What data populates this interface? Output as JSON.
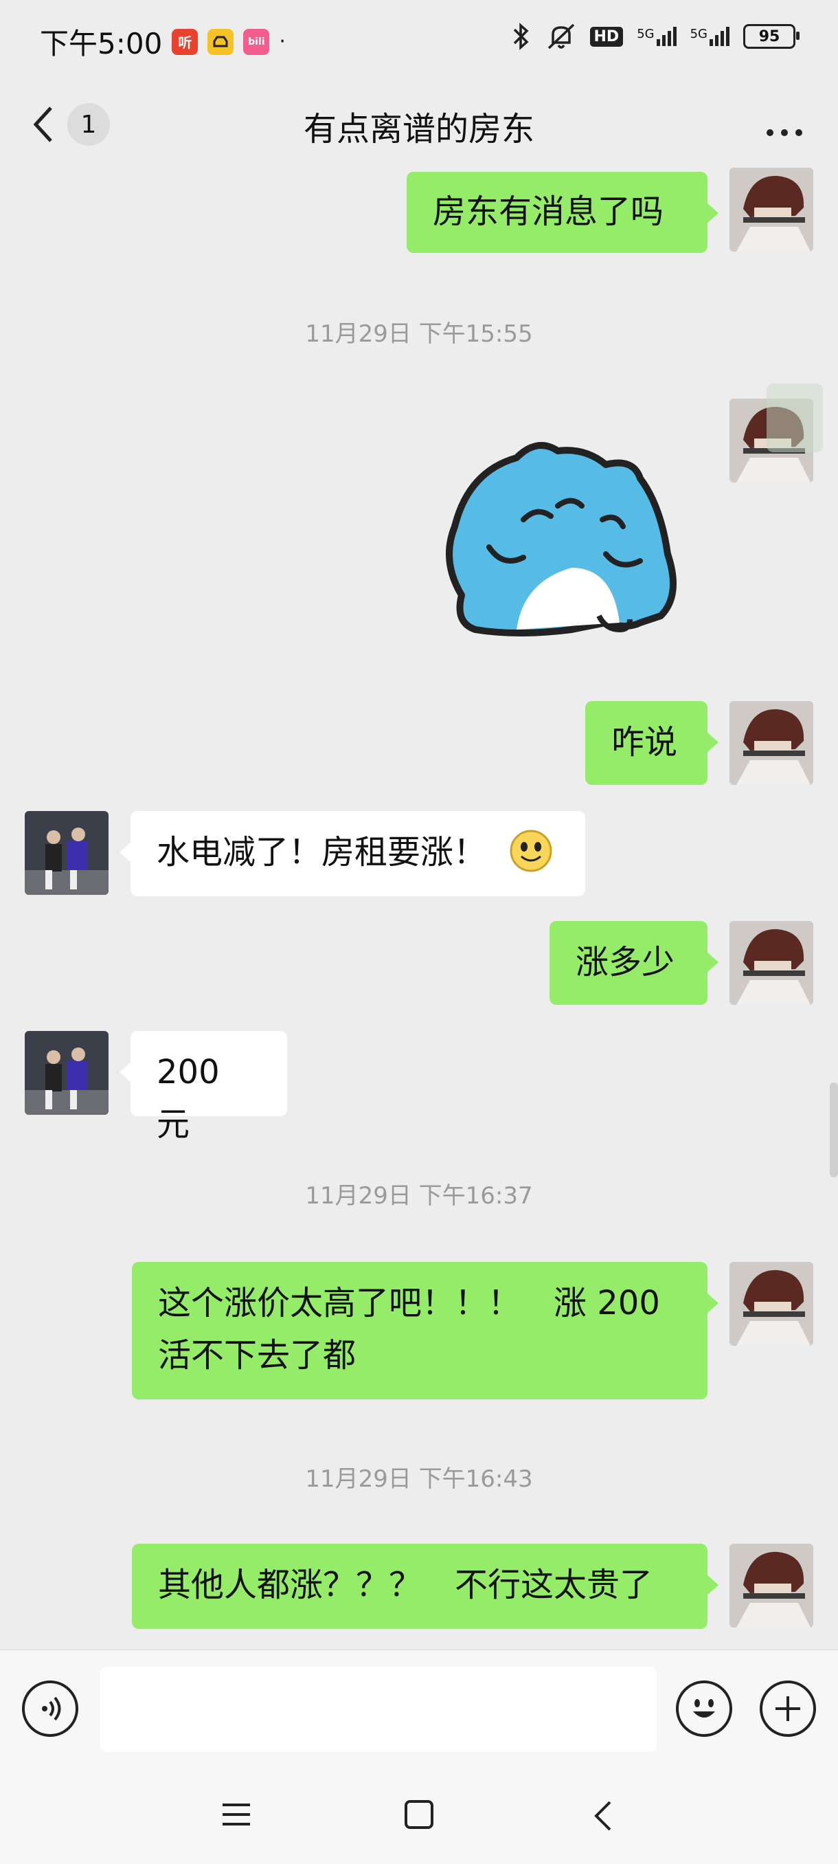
{
  "status_bar": {
    "time": "下午5:00",
    "app_badges": [
      {
        "icon": "ting-app-icon",
        "label": "听",
        "color": "#e8422e"
      },
      {
        "icon": "car-app-icon",
        "label": "",
        "color": "#f6c324"
      },
      {
        "icon": "bilibili-app-icon",
        "label": "bili",
        "color": "#f25d8e"
      }
    ],
    "hd_label": "HD",
    "network_1": "5G",
    "network_2": "5G",
    "battery": "95"
  },
  "header": {
    "unread_count": "1",
    "title": "有点离谱的房东"
  },
  "messages": [
    {
      "type": "text",
      "direction": "out",
      "text": "房东有消息了吗"
    },
    {
      "type": "timestamp",
      "text": "11月29日 下午15:55"
    },
    {
      "type": "sticker",
      "direction": "out",
      "sticker": "blue-cat-sticker"
    },
    {
      "type": "text",
      "direction": "out",
      "text": "咋说"
    },
    {
      "type": "text",
      "direction": "in",
      "text": "水电减了！房租要涨！",
      "emoji": "smile-emoji"
    },
    {
      "type": "text",
      "direction": "out",
      "text": "涨多少"
    },
    {
      "type": "text",
      "direction": "in",
      "text": "200 元"
    },
    {
      "type": "timestamp",
      "text": "11月29日 下午16:37"
    },
    {
      "type": "text",
      "direction": "out",
      "lines": [
        "这个涨价太高了吧！！！　涨 200",
        "活不下去了都"
      ]
    },
    {
      "type": "timestamp",
      "text": "11月29日 下午16:43"
    },
    {
      "type": "text",
      "direction": "out",
      "text": "其他人都涨？？？　不行这太贵了"
    }
  ],
  "input": {
    "placeholder": "",
    "value": ""
  },
  "colors": {
    "out_bubble": "#95ec69",
    "in_bubble": "#ffffff",
    "background": "#ededed"
  }
}
